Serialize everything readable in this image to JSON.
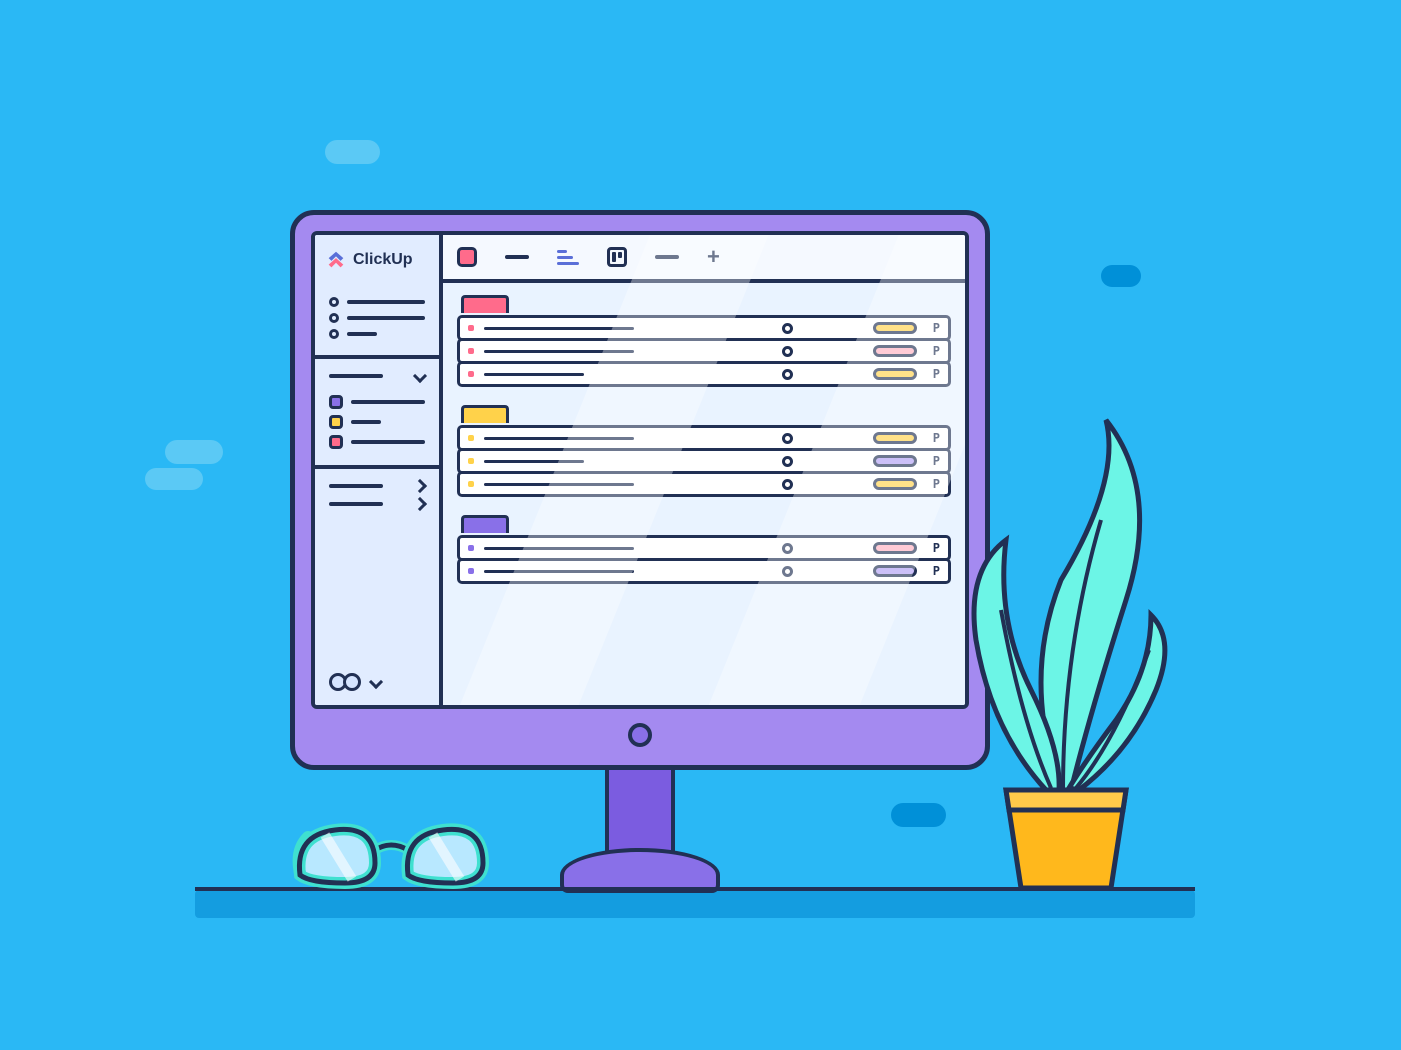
{
  "app_name": "ClickUp",
  "sidebar": {
    "nav_items": [
      "item1",
      "item2",
      "item3"
    ],
    "spaces": [
      {
        "color": "purple"
      },
      {
        "color": "yellow"
      },
      {
        "color": "pink"
      }
    ]
  },
  "topbar": {
    "views": [
      "list",
      "dash",
      "gantt",
      "board",
      "dash2",
      "add"
    ]
  },
  "task_groups": [
    {
      "color": "pink",
      "tasks": [
        {
          "bullet": "pink",
          "title_len": "long",
          "pill": "yellow",
          "flag": "P"
        },
        {
          "bullet": "pink",
          "title_len": "long",
          "pill": "pink",
          "flag": "P"
        },
        {
          "bullet": "pink",
          "title_len": "short",
          "pill": "yellow",
          "flag": "P"
        }
      ]
    },
    {
      "color": "yellow",
      "tasks": [
        {
          "bullet": "yellow",
          "title_len": "long",
          "pill": "yellow",
          "flag": "P"
        },
        {
          "bullet": "yellow",
          "title_len": "short",
          "pill": "purple",
          "flag": "P"
        },
        {
          "bullet": "yellow",
          "title_len": "long",
          "pill": "yellow",
          "flag": "P"
        }
      ]
    },
    {
      "color": "purple",
      "tasks": [
        {
          "bullet": "purple",
          "title_len": "long",
          "pill": "pink",
          "flag": "P"
        },
        {
          "bullet": "purple",
          "title_len": "long",
          "pill": "purple",
          "flag": "P"
        }
      ]
    }
  ],
  "decor": {
    "glasses_color": "#3fe0d0",
    "pot_color": "#ffb81c",
    "leaf_color": "#6cf5e6"
  }
}
